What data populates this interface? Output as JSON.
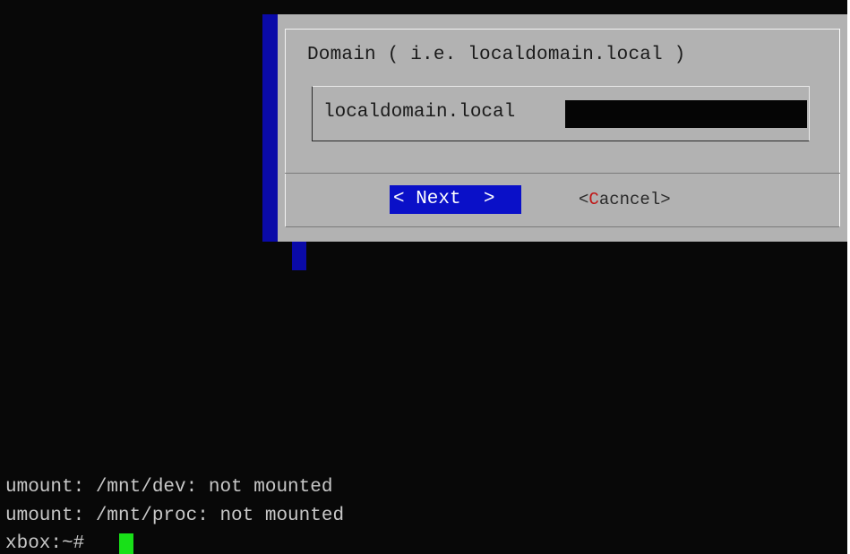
{
  "dialog": {
    "prompt": "Domain ( i.e. localdomain.local )",
    "input_value": "localdomain.local",
    "next_button": "< Next  >",
    "cancel_open": "<",
    "cancel_hotkey": "C",
    "cancel_rest": "acncel>"
  },
  "terminal": {
    "lines": [
      "umount: /mnt/dev: not mounted",
      "umount: /mnt/proc: not mounted",
      "xbox:~# "
    ]
  },
  "colors": {
    "background": "#080808",
    "dialog_backdrop": "#0a0aa8",
    "dialog_body": "#b2b2b2",
    "button_focus": "#0a10c8",
    "hotkey": "#c01818",
    "cursor": "#18e018"
  }
}
